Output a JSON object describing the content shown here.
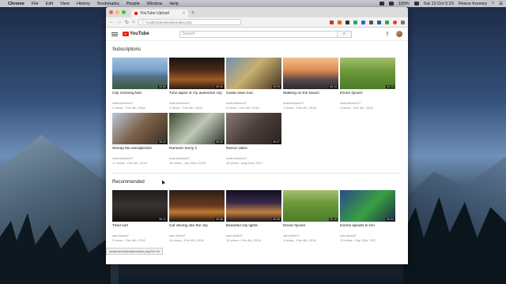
{
  "menubar": {
    "app": "Chrome",
    "menus": [
      "File",
      "Edit",
      "View",
      "History",
      "Bookmarks",
      "People",
      "Window",
      "Help"
    ],
    "battery": "100%",
    "datetime": "Sat 13 Oct  5:23",
    "user": "Reece Kenney"
  },
  "browser": {
    "tab_title": "YouTube Upload",
    "url": "localhost/videosite/index.php"
  },
  "youtube": {
    "logo_text": "YouTube",
    "search_placeholder": "Search",
    "search_button": "⌕"
  },
  "subscriptions": {
    "title": "Subscriptions",
    "videos": [
      {
        "title": "City zooming fast",
        "channel": "matt-leblanc47",
        "meta": "3 views - Feb 4th, 2018",
        "duration": "00:52",
        "thumb": "city"
      },
      {
        "title": "Time lapse of my awesome city",
        "channel": "matt-leblanc47",
        "meta": "3 views - Feb 4th, 2018",
        "duration": "00:20",
        "thumb": "night"
      },
      {
        "title": "Guitar town tour",
        "channel": "matt-leblanc47",
        "meta": "0 views - Feb 4th, 2018",
        "duration": "00:29",
        "thumb": "guitar"
      },
      {
        "title": "Walking on the beach",
        "channel": "matt-leblanc47",
        "meta": "7 views - Feb 4th, 2018",
        "duration": "00:13",
        "thumb": "beach"
      },
      {
        "title": "Drone flyover",
        "channel": "matt-leblanc47",
        "meta": "9 views - Feb 4th, 2018",
        "duration": "00:10",
        "thumb": "drone"
      },
      {
        "title": "Woody the woodpecker",
        "channel": "matt-leblanc47",
        "meta": "17 views - Feb 4th, 2018",
        "duration": "00:22",
        "thumb": "woodpecker"
      },
      {
        "title": "Ranveer funny 1",
        "channel": "matt-leblanc47",
        "meta": "16 views - Jan 23rd, 2018",
        "duration": "00:30",
        "thumb": "ranveer"
      },
      {
        "title": "Reece video",
        "channel": "matt-leblanc47",
        "meta": "26 views - Aug 23rd, 2017",
        "duration": "00:27",
        "thumb": "reece"
      }
    ]
  },
  "recommended": {
    "title": "Recommended",
    "videos": [
      {
        "title": "Tired out!",
        "channel": "sam-best47",
        "meta": "3 views - Feb 4th, 2018",
        "duration": "00:17",
        "thumb": "tired"
      },
      {
        "title": "Car driving into the city",
        "channel": "sam-best47",
        "meta": "10 views - Feb 4th, 2018",
        "duration": "00:38",
        "thumb": "car"
      },
      {
        "title": "Beautiful city lights",
        "channel": "sam-best47",
        "meta": "10 views - Feb 4th, 2018",
        "duration": "00:25",
        "thumb": "lights"
      },
      {
        "title": "Drone flyover",
        "channel": "sam-best47",
        "meta": "9 views - Feb 4th, 2018",
        "duration": "00:10",
        "thumb": "drone"
      },
      {
        "title": "Kermit speaks to tori",
        "channel": "sam-best47",
        "meta": "76 views - Sep 19th, 2017",
        "duration": "00:34",
        "thumb": "kermit"
      }
    ]
  },
  "status_url": "localhost/videosite/watch.php?id=34",
  "colors": {
    "brand_red": "#e62117",
    "meta_gray": "#888888"
  }
}
